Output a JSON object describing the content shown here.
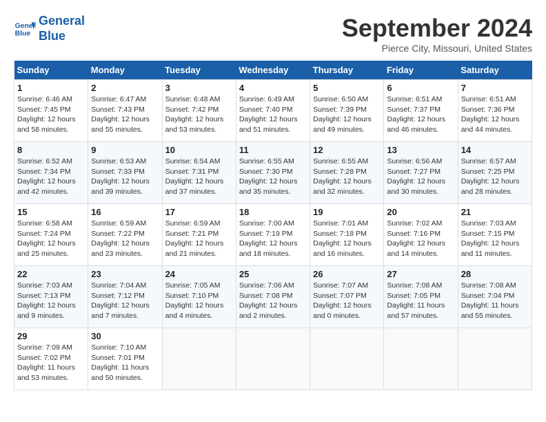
{
  "header": {
    "logo_line1": "General",
    "logo_line2": "Blue",
    "month_title": "September 2024",
    "location": "Pierce City, Missouri, United States"
  },
  "days_of_week": [
    "Sunday",
    "Monday",
    "Tuesday",
    "Wednesday",
    "Thursday",
    "Friday",
    "Saturday"
  ],
  "weeks": [
    [
      {
        "day": "1",
        "info": "Sunrise: 6:46 AM\nSunset: 7:45 PM\nDaylight: 12 hours\nand 58 minutes."
      },
      {
        "day": "2",
        "info": "Sunrise: 6:47 AM\nSunset: 7:43 PM\nDaylight: 12 hours\nand 55 minutes."
      },
      {
        "day": "3",
        "info": "Sunrise: 6:48 AM\nSunset: 7:42 PM\nDaylight: 12 hours\nand 53 minutes."
      },
      {
        "day": "4",
        "info": "Sunrise: 6:49 AM\nSunset: 7:40 PM\nDaylight: 12 hours\nand 51 minutes."
      },
      {
        "day": "5",
        "info": "Sunrise: 6:50 AM\nSunset: 7:39 PM\nDaylight: 12 hours\nand 49 minutes."
      },
      {
        "day": "6",
        "info": "Sunrise: 6:51 AM\nSunset: 7:37 PM\nDaylight: 12 hours\nand 46 minutes."
      },
      {
        "day": "7",
        "info": "Sunrise: 6:51 AM\nSunset: 7:36 PM\nDaylight: 12 hours\nand 44 minutes."
      }
    ],
    [
      {
        "day": "8",
        "info": "Sunrise: 6:52 AM\nSunset: 7:34 PM\nDaylight: 12 hours\nand 42 minutes."
      },
      {
        "day": "9",
        "info": "Sunrise: 6:53 AM\nSunset: 7:33 PM\nDaylight: 12 hours\nand 39 minutes."
      },
      {
        "day": "10",
        "info": "Sunrise: 6:54 AM\nSunset: 7:31 PM\nDaylight: 12 hours\nand 37 minutes."
      },
      {
        "day": "11",
        "info": "Sunrise: 6:55 AM\nSunset: 7:30 PM\nDaylight: 12 hours\nand 35 minutes."
      },
      {
        "day": "12",
        "info": "Sunrise: 6:55 AM\nSunset: 7:28 PM\nDaylight: 12 hours\nand 32 minutes."
      },
      {
        "day": "13",
        "info": "Sunrise: 6:56 AM\nSunset: 7:27 PM\nDaylight: 12 hours\nand 30 minutes."
      },
      {
        "day": "14",
        "info": "Sunrise: 6:57 AM\nSunset: 7:25 PM\nDaylight: 12 hours\nand 28 minutes."
      }
    ],
    [
      {
        "day": "15",
        "info": "Sunrise: 6:58 AM\nSunset: 7:24 PM\nDaylight: 12 hours\nand 25 minutes."
      },
      {
        "day": "16",
        "info": "Sunrise: 6:59 AM\nSunset: 7:22 PM\nDaylight: 12 hours\nand 23 minutes."
      },
      {
        "day": "17",
        "info": "Sunrise: 6:59 AM\nSunset: 7:21 PM\nDaylight: 12 hours\nand 21 minutes."
      },
      {
        "day": "18",
        "info": "Sunrise: 7:00 AM\nSunset: 7:19 PM\nDaylight: 12 hours\nand 18 minutes."
      },
      {
        "day": "19",
        "info": "Sunrise: 7:01 AM\nSunset: 7:18 PM\nDaylight: 12 hours\nand 16 minutes."
      },
      {
        "day": "20",
        "info": "Sunrise: 7:02 AM\nSunset: 7:16 PM\nDaylight: 12 hours\nand 14 minutes."
      },
      {
        "day": "21",
        "info": "Sunrise: 7:03 AM\nSunset: 7:15 PM\nDaylight: 12 hours\nand 11 minutes."
      }
    ],
    [
      {
        "day": "22",
        "info": "Sunrise: 7:03 AM\nSunset: 7:13 PM\nDaylight: 12 hours\nand 9 minutes."
      },
      {
        "day": "23",
        "info": "Sunrise: 7:04 AM\nSunset: 7:12 PM\nDaylight: 12 hours\nand 7 minutes."
      },
      {
        "day": "24",
        "info": "Sunrise: 7:05 AM\nSunset: 7:10 PM\nDaylight: 12 hours\nand 4 minutes."
      },
      {
        "day": "25",
        "info": "Sunrise: 7:06 AM\nSunset: 7:08 PM\nDaylight: 12 hours\nand 2 minutes."
      },
      {
        "day": "26",
        "info": "Sunrise: 7:07 AM\nSunset: 7:07 PM\nDaylight: 12 hours\nand 0 minutes."
      },
      {
        "day": "27",
        "info": "Sunrise: 7:08 AM\nSunset: 7:05 PM\nDaylight: 11 hours\nand 57 minutes."
      },
      {
        "day": "28",
        "info": "Sunrise: 7:08 AM\nSunset: 7:04 PM\nDaylight: 11 hours\nand 55 minutes."
      }
    ],
    [
      {
        "day": "29",
        "info": "Sunrise: 7:09 AM\nSunset: 7:02 PM\nDaylight: 11 hours\nand 53 minutes."
      },
      {
        "day": "30",
        "info": "Sunrise: 7:10 AM\nSunset: 7:01 PM\nDaylight: 11 hours\nand 50 minutes."
      },
      {
        "day": "",
        "info": ""
      },
      {
        "day": "",
        "info": ""
      },
      {
        "day": "",
        "info": ""
      },
      {
        "day": "",
        "info": ""
      },
      {
        "day": "",
        "info": ""
      }
    ]
  ]
}
